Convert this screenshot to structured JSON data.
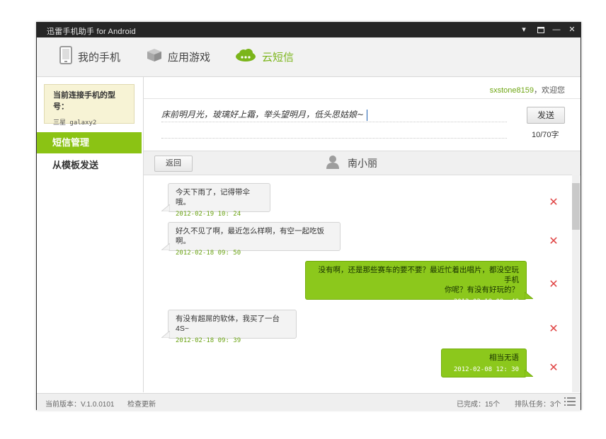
{
  "window": {
    "title": "迅雷手机助手  for Android",
    "controls": {
      "menu": "▾",
      "restore": "▪",
      "minimize": "—",
      "close": "✕"
    }
  },
  "nav": {
    "tabs": [
      {
        "label": "我的手机",
        "icon": "phone-icon",
        "active": false
      },
      {
        "label": "应用游戏",
        "icon": "box-icon",
        "active": false
      },
      {
        "label": "云短信",
        "icon": "cloud-icon",
        "active": true
      }
    ]
  },
  "sidebar": {
    "device_header": "当前连接手机的型号：",
    "device_model": "三星 galaxy2",
    "menu": [
      {
        "label": "短信管理",
        "active": true
      },
      {
        "label": "从模板发送",
        "active": false
      }
    ]
  },
  "header": {
    "username": "sxstone8159",
    "welcome": "，欢迎您"
  },
  "compose": {
    "text": "床前明月光，玻璃好上霜，举头望明月，低头思姑娘~",
    "send_label": "发送",
    "counter": "10/70字"
  },
  "conversation": {
    "back_label": "返回",
    "contact_name": "南小丽",
    "messages": [
      {
        "direction": "in",
        "text": "今天下雨了，记得带伞哦。",
        "time": "2012-02-19 10: 24"
      },
      {
        "direction": "in",
        "text": "好久不见了啊，最近怎么样啊，有空一起吃饭啊。",
        "time": "2012-02-18 09: 50"
      },
      {
        "direction": "out",
        "text": "没有啊，还是那些赛车的要不要？最近忙着出唱片，都没空玩手机",
        "text2": "你呢？有没有好玩的？",
        "time": "2012-02-18 09: 48"
      },
      {
        "direction": "in",
        "text": "有没有超屌的软体，我买了一台4S~",
        "time": "2012-02-18 09: 39"
      },
      {
        "direction": "out",
        "text": "相当无语",
        "time": "2012-02-08 12: 30"
      }
    ]
  },
  "status": {
    "version": "当前版本：V.1.0.0101",
    "check_update": "检查更新",
    "completed": "已完成：15个",
    "queue": "排队任务：3个"
  },
  "colors": {
    "accent": "#8bc314",
    "delete": "#e04545",
    "titlebar": "#262626"
  }
}
